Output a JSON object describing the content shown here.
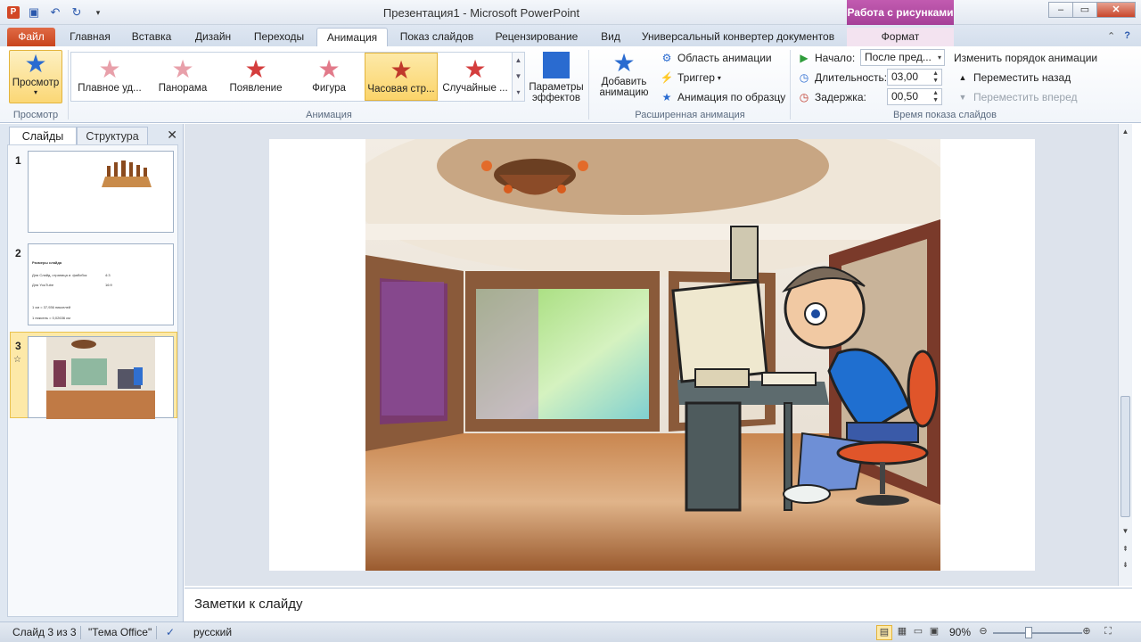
{
  "app": {
    "title": "Презентация1 - Microsoft PowerPoint",
    "context_tab_header": "Работа с рисунками",
    "icon_letter": "P"
  },
  "window_controls": {
    "minimize": "–",
    "maximize": "▭",
    "close": "✕"
  },
  "tabs": [
    {
      "label": "Файл"
    },
    {
      "label": "Главная"
    },
    {
      "label": "Вставка"
    },
    {
      "label": "Дизайн"
    },
    {
      "label": "Переходы"
    },
    {
      "label": "Анимация"
    },
    {
      "label": "Показ слайдов"
    },
    {
      "label": "Рецензирование"
    },
    {
      "label": "Вид"
    },
    {
      "label": "Универсальный конвертер документов"
    },
    {
      "label": "Формат"
    }
  ],
  "ribbon": {
    "preview": {
      "label": "Просмотр",
      "group": "Просмотр"
    },
    "animation_group": "Анимация",
    "gallery": [
      {
        "label": "Плавное уд...",
        "color": "#e8a0aa"
      },
      {
        "label": "Панорама",
        "color": "#e8a0aa"
      },
      {
        "label": "Появление",
        "color": "#d43d3d"
      },
      {
        "label": "Фигура",
        "color": "#e27a8a"
      },
      {
        "label": "Часовая стр...",
        "color": "#c0392b"
      },
      {
        "label": "Случайные ...",
        "color": "#d43d3d"
      }
    ],
    "effects_params": {
      "line1": "Параметры",
      "line2": "эффектов"
    },
    "add_animation": {
      "line1": "Добавить",
      "line2": "анимацию"
    },
    "advanced": {
      "group": "Расширенная анимация",
      "animation_pane": "Область анимации",
      "trigger": "Триггер",
      "painter": "Анимация по образцу"
    },
    "timing": {
      "group": "Время показа слайдов",
      "start_label": "Начало:",
      "start_value": "После пред...",
      "duration_label": "Длительность:",
      "duration_value": "03,00",
      "delay_label": "Задержка:",
      "delay_value": "00,50",
      "reorder_title": "Изменить порядок анимации",
      "move_earlier": "Переместить назад",
      "move_later": "Переместить вперед"
    }
  },
  "left_pane": {
    "tab_slides": "Слайды",
    "tab_outline": "Структура",
    "close": "✕",
    "slides": [
      {
        "number": "1"
      },
      {
        "number": "2",
        "lines": [
          {
            "text": "Размеры слайда",
            "value": ""
          },
          {
            "text": "Для Слайд, страница и. фабобск",
            "value": "4:3"
          },
          {
            "text": "Для YouTube",
            "value": "16:9"
          },
          {
            "text": "1 см = 37,936 пикселей",
            "value": ""
          },
          {
            "text": "1 пиксель = 0,02636 см",
            "value": ""
          }
        ]
      },
      {
        "number": "3"
      }
    ]
  },
  "notes": {
    "placeholder": "Заметки к слайду"
  },
  "status": {
    "slide": "Слайд 3 из 3",
    "theme": "\"Тема Office\"",
    "language": "русский",
    "zoom": "90%",
    "zoom_fraction": 0.4
  }
}
